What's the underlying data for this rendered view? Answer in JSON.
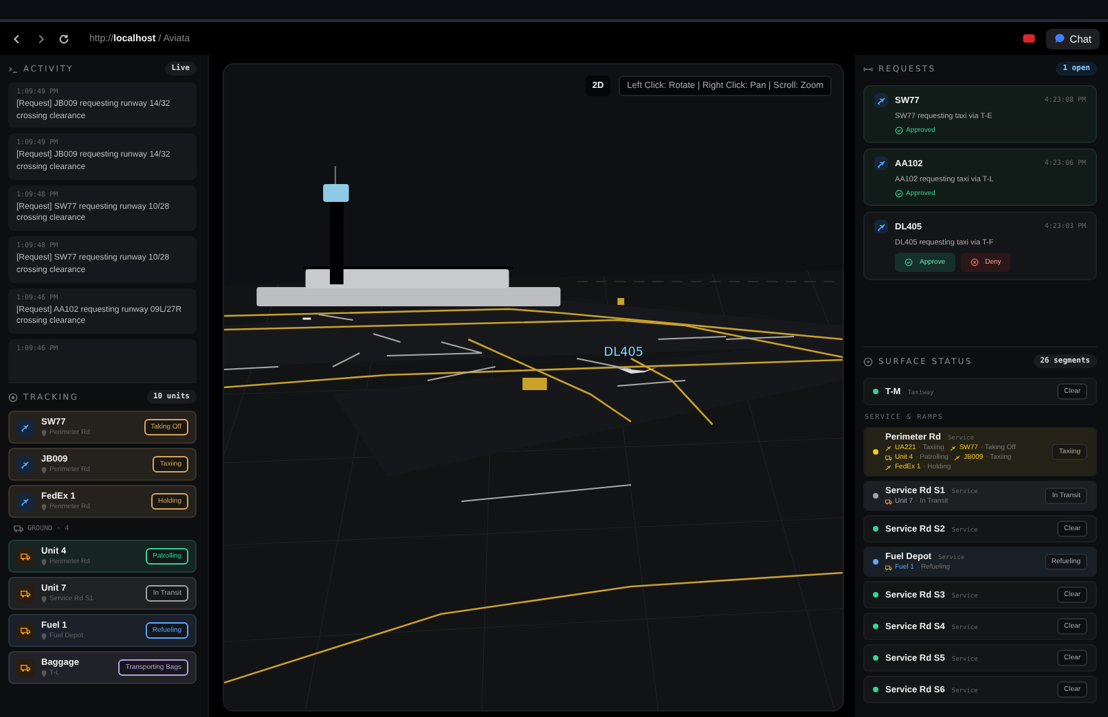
{
  "browser": {
    "address": "http://**localhost** / Aviata",
    "chat_label": "Chat"
  },
  "activity": {
    "title": "ACTIVITY",
    "badge": "Live",
    "entries": [
      {
        "time": "1:09:49 PM",
        "text": "[Request] JB009 requesting runway 14/32 crossing clearance"
      },
      {
        "time": "1:09:49 PM",
        "text": "[Request] JB009 requesting runway 14/32 crossing clearance"
      },
      {
        "time": "1:09:48 PM",
        "text": "[Request] SW77 requesting runway 10/28 crossing clearance"
      },
      {
        "time": "1:09:48 PM",
        "text": "[Request] SW77 requesting runway 10/28 crossing clearance"
      },
      {
        "time": "1:09:46 PM",
        "text": "[Request] AA102 requesting runway 09L/27R crossing clearance"
      },
      {
        "time": "1:09:46 PM"
      }
    ]
  },
  "tracking": {
    "title": "TRACKING",
    "badge": "10 units",
    "groups": [
      {
        "kind": "aircraft",
        "units": [
          {
            "name": "SW77",
            "location": "Perimeter Rd",
            "status": "Taking Off",
            "color": "#d9a55a"
          },
          {
            "name": "JB009",
            "location": "Perimeter Rd",
            "status": "Taxiing",
            "color": "#d9a55a"
          },
          {
            "name": "FedEx 1",
            "location": "Perimeter Rd",
            "status": "Holding",
            "color": "#d9a55a"
          }
        ]
      },
      {
        "heading": "GROUND · 4",
        "kind": "ground",
        "units": [
          {
            "name": "Unit 4",
            "location": "Perimeter Rd",
            "status": "Patrolling",
            "color": "#34d399"
          },
          {
            "name": "Unit 7",
            "location": "Service Rd S1",
            "status": "In Transit",
            "color": "#a3a3a3"
          },
          {
            "name": "Fuel 1",
            "location": "Fuel Depot",
            "status": "Refueling",
            "color": "#60a5fa"
          },
          {
            "name": "Baggage",
            "location": "T-L",
            "status": "Transporting Bags",
            "color": "#b4a0e0"
          }
        ]
      }
    ]
  },
  "viewport": {
    "mode_button": "2D",
    "hint": "Left Click: Rotate | Right Click: Pan | Scroll: Zoom",
    "aircraft_label": "DL405"
  },
  "requests": {
    "title": "REQUESTS",
    "badge": "1 open",
    "items": [
      {
        "callsign": "SW77",
        "time": "4:23:08 PM",
        "text": "SW77 requesting taxi via T-E",
        "kind": "approved",
        "status": "Approved"
      },
      {
        "callsign": "AA102",
        "time": "4:23:06 PM",
        "text": "AA102 requesting taxi via T-L",
        "kind": "approved",
        "status": "Approved"
      },
      {
        "callsign": "DL405",
        "time": "4:23:03 PM",
        "text": "DL405 requesting taxi via T-F",
        "kind": "pending",
        "actions": [
          "Approve",
          "Deny"
        ]
      }
    ]
  },
  "surface": {
    "title": "SURFACE STATUS",
    "badge": "26 segments",
    "sections": [
      {
        "segments": [
          {
            "name": "T-M",
            "type": "Taxiway",
            "status": "Clear",
            "color": "#34d399"
          }
        ]
      },
      {
        "heading": "SERVICE & RAMPS",
        "segments": [
          {
            "name": "Perimeter Rd",
            "type": "Service",
            "status": "Taxiing",
            "color": "#facc15",
            "occupants": [
              {
                "kind": "aircraft",
                "name": "UA221",
                "status": "· Taxiing"
              },
              {
                "kind": "aircraft",
                "name": "SW77",
                "status": "· Taking Off"
              },
              {
                "kind": "ground",
                "name": "Unit 4",
                "status": "· Patrolling"
              },
              {
                "kind": "aircraft",
                "name": "JB009",
                "status": "· Taxiing"
              },
              {
                "kind": "aircraft",
                "name": "FedEx 1",
                "status": "· Holding"
              }
            ]
          },
          {
            "name": "Service Rd S1",
            "type": "Service",
            "status": "In Transit",
            "color": "#9ca3af",
            "occupants": [
              {
                "kind": "ground",
                "name": "Unit 7",
                "status": "· In Transit"
              }
            ]
          },
          {
            "name": "Service Rd S2",
            "type": "Service",
            "status": "Clear",
            "color": "#34d399"
          },
          {
            "name": "Fuel Depot",
            "type": "Service",
            "status": "Refueling",
            "color": "#60a5fa",
            "occupants": [
              {
                "kind": "ground",
                "name": "Fuel 1",
                "status": "· Refueling"
              }
            ]
          },
          {
            "name": "Service Rd S3",
            "type": "Service",
            "status": "Clear",
            "color": "#34d399"
          },
          {
            "name": "Service Rd S4",
            "type": "Service",
            "status": "Clear",
            "color": "#34d399"
          },
          {
            "name": "Service Rd S5",
            "type": "Service",
            "status": "Clear",
            "color": "#34d399"
          },
          {
            "name": "Service Rd S6",
            "type": "Service",
            "status": "Clear",
            "color": "#34d399"
          }
        ]
      }
    ]
  }
}
